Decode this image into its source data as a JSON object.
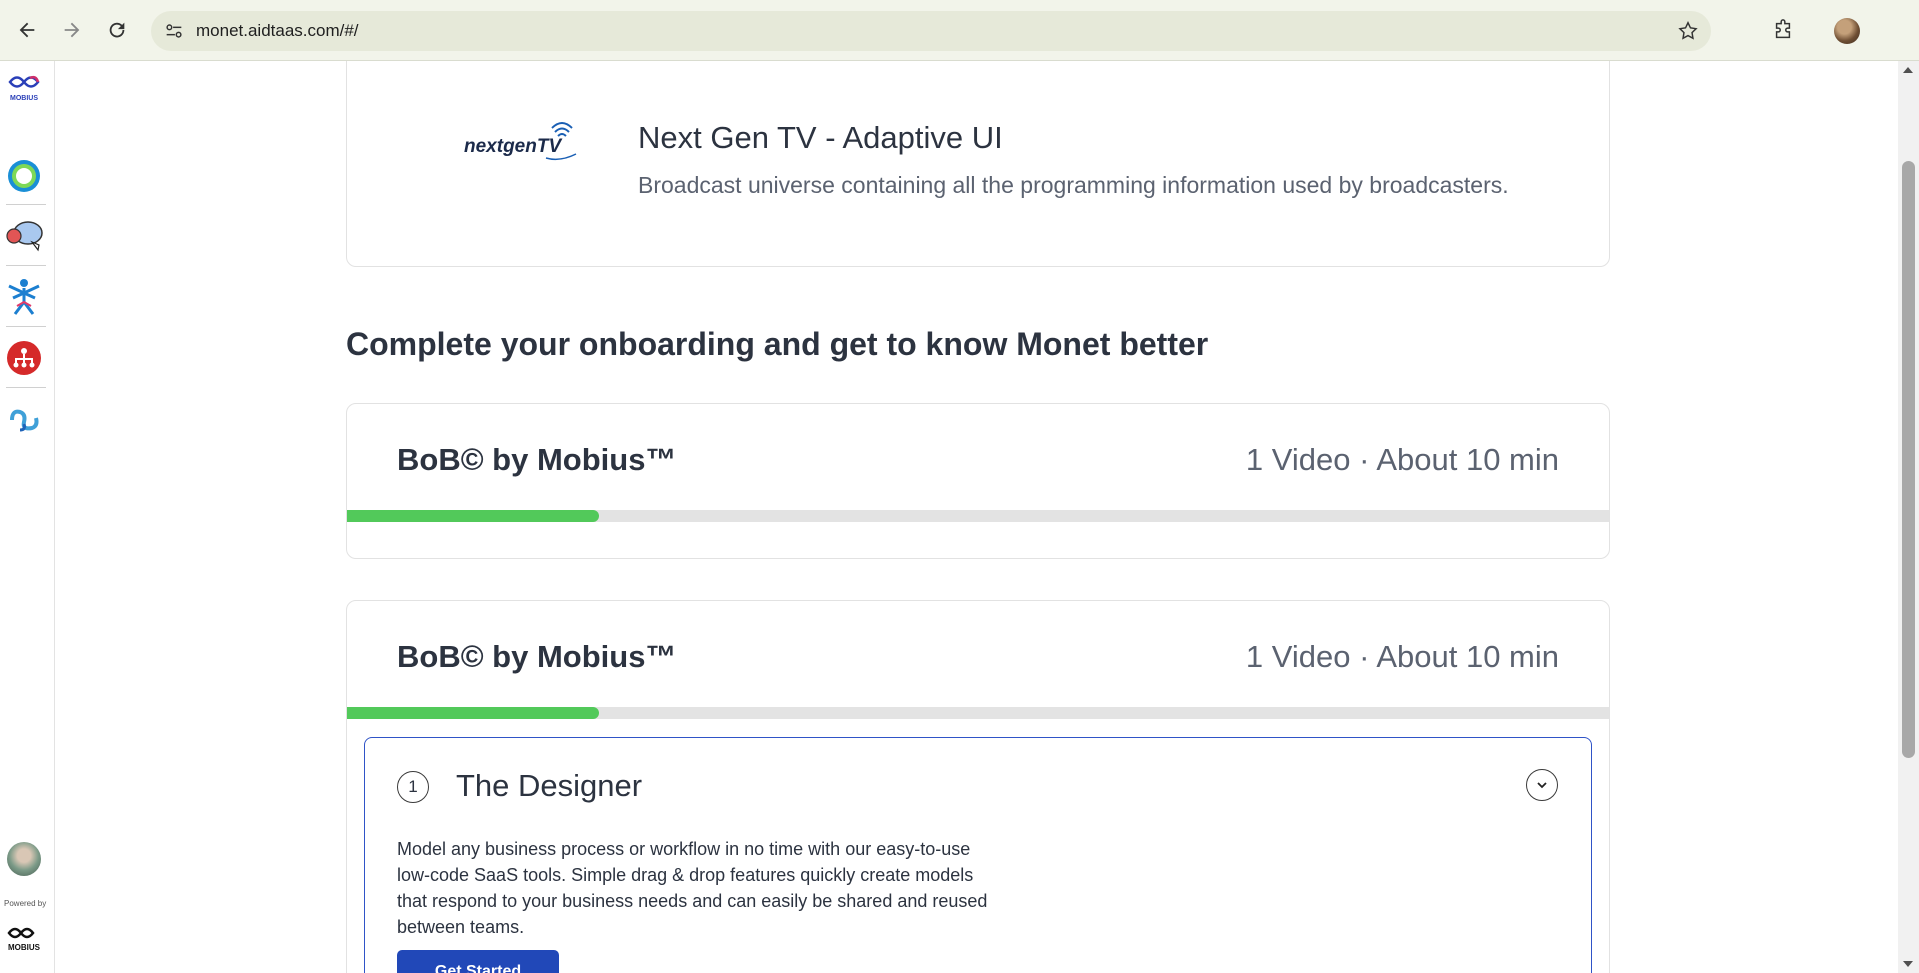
{
  "browser": {
    "url": "monet.aidtaas.com/#/"
  },
  "sidebar": {
    "powered_by": "Powered by",
    "bottom_logo_text": "MOBIUS",
    "top_logo_text": "MOBIUS"
  },
  "featured": {
    "logo_text": "nextgenTV",
    "title": "Next Gen TV - Adaptive UI",
    "description": "Broadcast universe containing all the programming information used by broadcasters."
  },
  "onboarding": {
    "heading": "Complete your onboarding and get to know Monet better",
    "courses": [
      {
        "title": "BoB© by Mobius™",
        "meta": "1 Video · About 10 min",
        "progress": 0.2
      },
      {
        "title": "BoB© by Mobius™",
        "meta": "1 Video · About 10 min",
        "progress": 0.2
      }
    ],
    "lesson": {
      "number": "1",
      "title": "The Designer",
      "description": "Model any business process or workflow in no time with our easy-to-use low-code SaaS tools. Simple drag & drop features quickly create models that respond to your business needs and can easily be shared and reused between teams.",
      "button_label": "Get Started"
    }
  },
  "colors": {
    "accent": "#2148b8",
    "progress": "#52c95a",
    "lesson_border": "#2f53c7"
  }
}
